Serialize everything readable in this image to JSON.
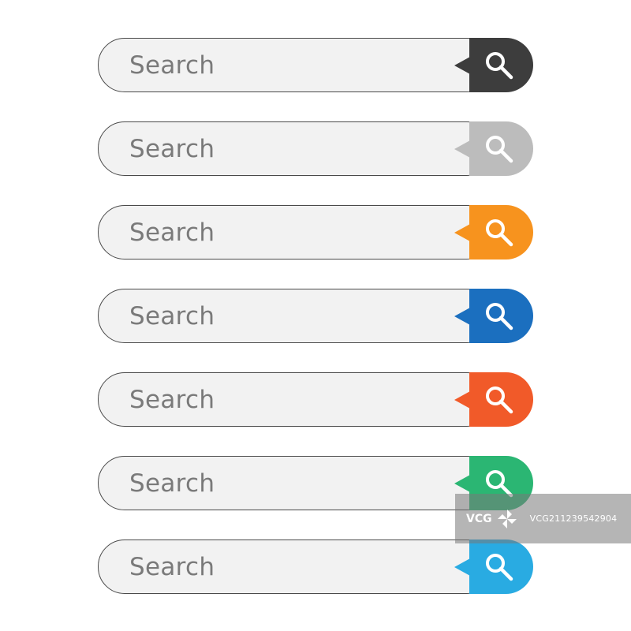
{
  "search_bars": [
    {
      "placeholder": "Search",
      "button_color": "#3d3d3d",
      "icon": "search-icon"
    },
    {
      "placeholder": "Search",
      "button_color": "#bcbcbc",
      "icon": "search-icon"
    },
    {
      "placeholder": "Search",
      "button_color": "#f7931e",
      "icon": "search-icon"
    },
    {
      "placeholder": "Search",
      "button_color": "#1b6fbf",
      "icon": "search-icon"
    },
    {
      "placeholder": "Search",
      "button_color": "#f15a29",
      "icon": "search-icon"
    },
    {
      "placeholder": "Search",
      "button_color": "#2bb673",
      "icon": "search-icon"
    },
    {
      "placeholder": "Search",
      "button_color": "#29abe2",
      "icon": "search-icon"
    }
  ],
  "watermark": {
    "logo": "VCG",
    "id": "VCG211239542904"
  }
}
